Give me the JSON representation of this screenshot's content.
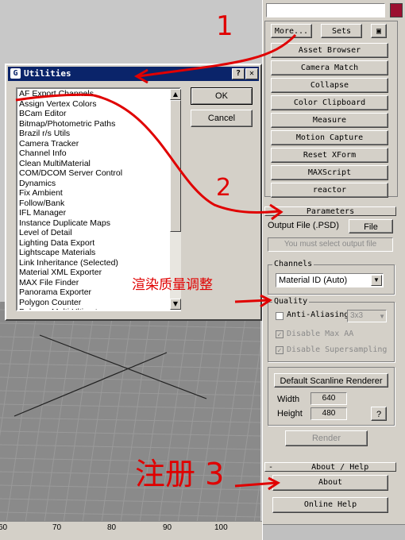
{
  "dialog": {
    "title": "Utilities",
    "title_help": "?",
    "title_close": "✕",
    "ok": "OK",
    "cancel": "Cancel",
    "items": [
      "AF Export Channels",
      "Assign Vertex Colors",
      "BCam Editor",
      "Bitmap/Photometric Paths",
      "Brazil r/s Utils",
      "Camera Tracker",
      "Channel Info",
      "Clean MultiMaterial",
      "COM/DCOM Server Control",
      "Dynamics",
      "Fix Ambient",
      "Follow/Bank",
      "IFL Manager",
      "Instance Duplicate Maps",
      "Level of Detail",
      "Lighting Data Export",
      "Lightscape Materials",
      "Link Inheritance (Selected)",
      "Material XML Exporter",
      "MAX File Finder",
      "Panorama Exporter",
      "Polygon Counter",
      "Polygon Multi Ultimate"
    ]
  },
  "panel": {
    "more": "More...",
    "sets": "Sets",
    "utilities": [
      "Asset Browser",
      "Camera Match",
      "Collapse",
      "Color Clipboard",
      "Measure",
      "Motion Capture",
      "Reset XForm",
      "MAXScript",
      "reactor"
    ],
    "parameters_title": "Parameters",
    "output_label": "Output File (.PSD)",
    "file_btn": "File",
    "select_output": "You must select output file",
    "channels_label": "Channels",
    "channels_value": "Material ID (Auto)",
    "quality_label": "Quality",
    "antialias": "Anti-Aliasing",
    "aa_value": "3x3",
    "disable_max_aa": "Disable Max AA",
    "disable_super": "Disable Supersampling",
    "renderer": "Default Scanline Renderer",
    "width_label": "Width",
    "width_val": "640",
    "height_label": "Height",
    "height_val": "480",
    "q_btn": "?",
    "render": "Render",
    "about_title": "About / Help",
    "about_minus": "-",
    "about": "About",
    "online_help": "Online Help"
  },
  "ruler": {
    "ticks": [
      "60",
      "70",
      "80",
      "90",
      "100"
    ]
  },
  "annotations": {
    "n1": "1",
    "n2": "2",
    "quality_note": "渲染质量调整",
    "register": "注册 3"
  },
  "colors": {
    "annotation": "#e00000",
    "title_bar": "#0a246a",
    "swatch": "#9b1030"
  }
}
